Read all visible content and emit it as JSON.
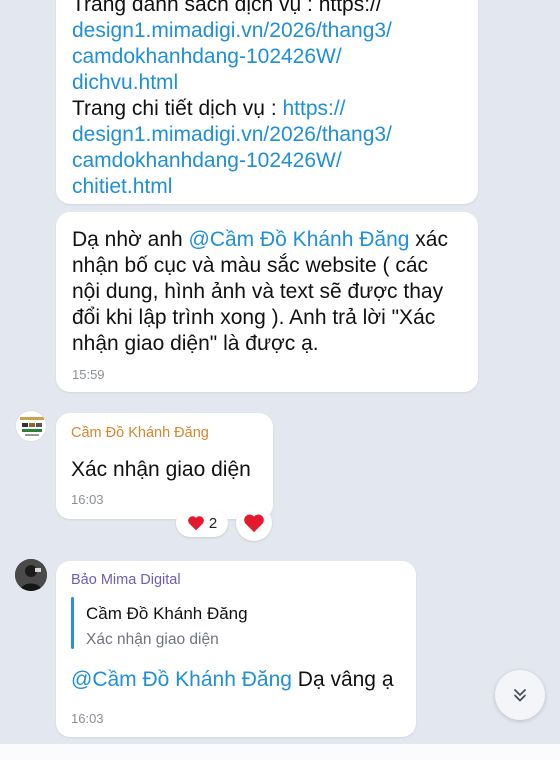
{
  "colors": {
    "background": "#e3e7ef",
    "link": "#1f8fd6",
    "sender_orange": "#d6862b",
    "sender_purple": "#6a5fb5",
    "heart": "#e5192e",
    "quote_bar": "#2a8ed8"
  },
  "msg1": {
    "partial_top": "Trang danh sách dịch vụ : https://",
    "lines": [
      {
        "text": "design1.mimadigi.vn/2026/thang3/",
        "link": true
      },
      {
        "text": "camdokhanhdang-102426W/",
        "link": true
      },
      {
        "text": "dichvu.html",
        "link": true
      }
    ],
    "detail_label": "Trang chi tiết dịch vụ : ",
    "detail_link_1": "https://",
    "detail_link_2": "design1.mimadigi.vn/2026/thang3/",
    "detail_link_3": "camdokhanhdang-102426W/",
    "detail_link_4": "chitiet.html"
  },
  "msg2": {
    "prefix": "Dạ nhờ anh ",
    "mention": "@Cầm Đồ Khánh Đăng",
    "line1_suffix": "  xác",
    "line2": "nhận bố cục và màu sắc website ( các",
    "line3": "nội dung, hình ảnh và text sẽ được thay",
    "line4": "đổi khi lập trình xong ). Anh trả lời \"Xác",
    "line5": "nhận giao diện\" là được ạ.",
    "time": "15:59"
  },
  "msg3": {
    "sender": "Cầm Đồ Khánh Đăng",
    "text": "Xác nhận giao diện",
    "time": "16:03",
    "reaction_icon": "heart-icon",
    "reaction_count": "2",
    "my_reaction_icon": "heart-icon"
  },
  "msg4": {
    "sender": "Bảo Mima Digital",
    "quote_sender": "Cầm Đồ Khánh Đăng",
    "quote_text": "Xác nhận giao diện",
    "mention": "@Cầm Đồ Khánh Đăng",
    "text": " Dạ vâng ạ",
    "time": "16:03"
  },
  "scroll_button_icon": "double-chevron-down-icon"
}
